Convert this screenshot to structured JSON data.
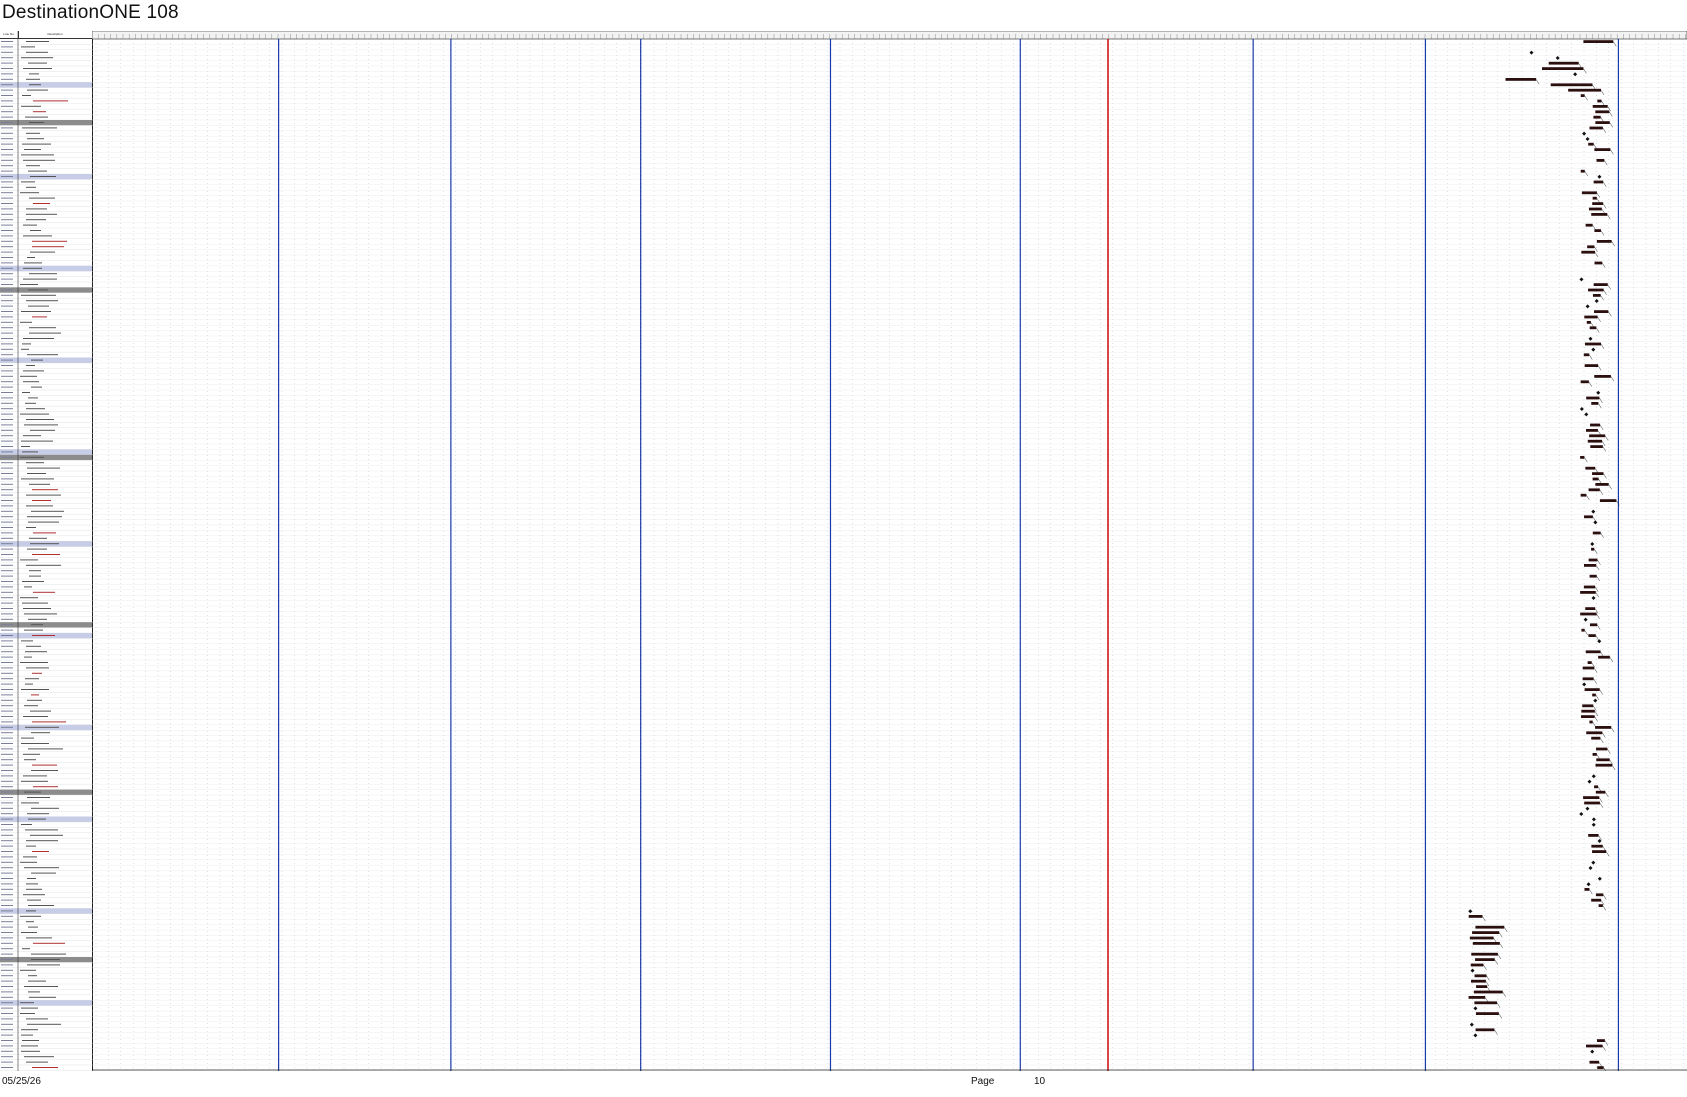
{
  "document": {
    "title": "DestinationONE 108"
  },
  "columns": {
    "col1": "Line No.",
    "col2": "Description"
  },
  "footer": {
    "date": "05/25/26",
    "page_label": "Page",
    "page_number": "10"
  },
  "colors": {
    "grid": "#9aa3b0",
    "blue_marker": "#1a3aa8",
    "red_marker": "#d01818",
    "summary_band": "#c7cde6",
    "phase_band": "#8c8c8c",
    "task_bar": "#2b0f0f"
  },
  "timeline": {
    "blue_marker_fractions": [
      0.117,
      0.225,
      0.344,
      0.463,
      0.582,
      0.728,
      0.836,
      0.957
    ],
    "red_marker_fraction": 0.637
  }
}
